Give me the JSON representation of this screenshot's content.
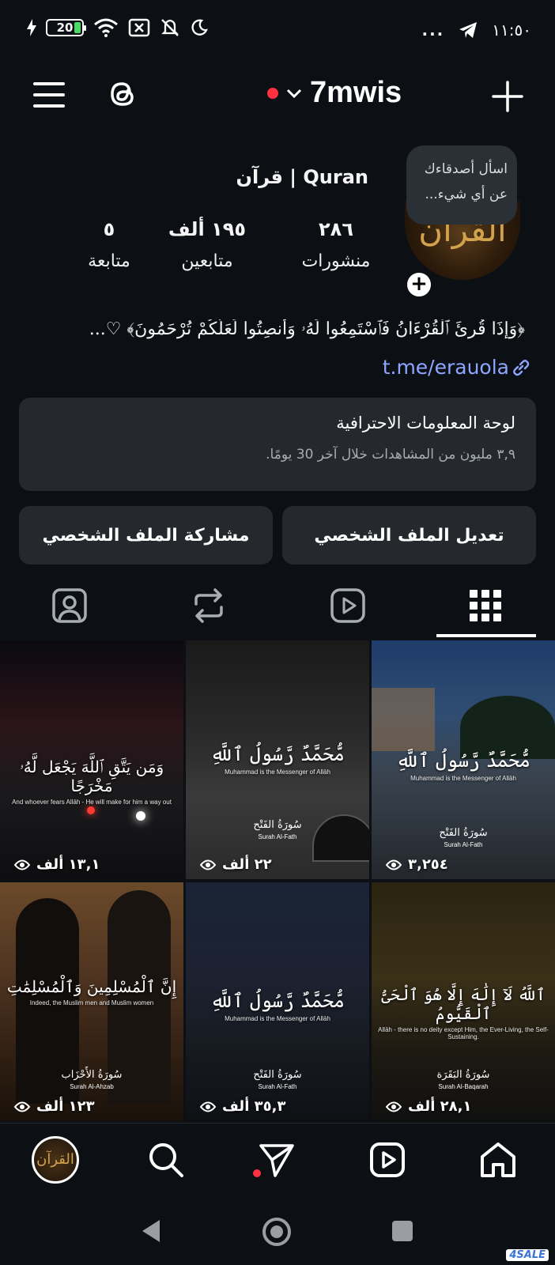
{
  "status_bar": {
    "battery": "20",
    "time": "١١:٥٠",
    "more": "..."
  },
  "header": {
    "username": "7mwis"
  },
  "profile": {
    "name": "Quran | قرآن",
    "note": "اسأل أصدقاءك عن أي شيء...",
    "stats": [
      {
        "value": "٢٨٦",
        "label": "منشورات"
      },
      {
        "value": "١٩٥ ألف",
        "label": "متابعين"
      },
      {
        "value": "٥",
        "label": "متابعة"
      }
    ],
    "bio": "﴿وَإِذَا قُرِئَ ٱلْقُرْءَانُ فَٱسْتَمِعُوا لَهُۥ وَأَنصِتُوا لَعَلَّكُمْ تُرْحَمُونَ﴾ ♡...",
    "link": "t.me/erauola"
  },
  "dashboard": {
    "title": "لوحة المعلومات الاحترافية",
    "subtitle": "٣,٩ مليون من المشاهدات خلال آخر 30 يومًا."
  },
  "buttons": {
    "edit": "تعديل الملف الشخصي",
    "share": "مشاركة الملف الشخصي"
  },
  "tabs": [
    "grid-icon",
    "reels-icon",
    "reposts-icon",
    "tagged-icon"
  ],
  "posts": [
    {
      "title": "وَمَن يَتَّقِ ٱللَّهَ يَجْعَل لَّهُۥ مَخْرَجًا",
      "translation": "And whoever fears Allāh - He will make for him a way out",
      "surah": "",
      "surah_en": "",
      "views": "١٣,١ ألف"
    },
    {
      "title": "مُّحَمَّدٌ رَّسُولُ ٱللَّهِ",
      "translation": "Muhammad is the Messenger of Allāh",
      "surah": "سُورَةُ الفَتْح",
      "surah_en": "Surah Al-Fath",
      "views": "٢٢ ألف"
    },
    {
      "title": "مُّحَمَّدٌ رَّسُولُ ٱللَّهِ",
      "translation": "Muhammad is the Messenger of Allāh",
      "surah": "سُورَةُ الفَتْح",
      "surah_en": "Surah Al-Fath",
      "views": "٣,٢٥٤"
    },
    {
      "title": "إِنَّ ٱلْمُسْلِمِينَ وَٱلْمُسْلِمَٰتِ",
      "translation": "Indeed, the Muslim men and Muslim women",
      "surah": "سُورَةُ الأَحْزَاب",
      "surah_en": "Surah Al-Ahzab",
      "views": "١٢٣ ألف"
    },
    {
      "title": "مُّحَمَّدٌ رَّسُولُ ٱللَّهِ",
      "translation": "Muhammad is the Messenger of Allāh",
      "surah": "سُورَةُ الفَتْح",
      "surah_en": "Surah Al-Fath",
      "views": "٣٥,٣ ألف"
    },
    {
      "title": "ٱللَّهُ لَآ إِلَٰهَ إِلَّا هُوَ ٱلْحَىُّ ٱلْقَيُّومُ",
      "translation": "Allāh - there is no deity except Him, the Ever-Living, the Self-Sustaining.",
      "surah": "سُورَةُ البَقَرَة",
      "surah_en": "Surah Al-Baqarah",
      "views": "٢٨,١ ألف"
    }
  ],
  "bottom_nav": [
    "profile-avatar",
    "search-icon",
    "direct-icon",
    "reels-icon",
    "home-icon"
  ],
  "watermark": "4SALE"
}
